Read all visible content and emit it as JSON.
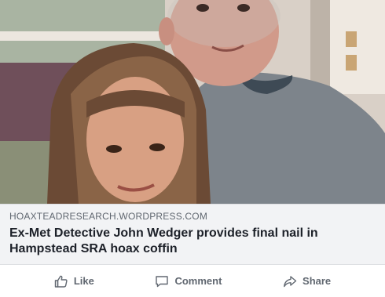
{
  "post": {
    "image": {
      "description_icon": "photo-of-man-and-woman"
    },
    "link_preview": {
      "domain": "HOAXTEADRESEARCH.WORDPRESS.COM",
      "headline": "Ex-Met Detective John Wedger provides final nail in Hampstead SRA hoax coffin"
    },
    "actions": [
      {
        "label": "Like",
        "icon": "thumbs-up-icon"
      },
      {
        "label": "Comment",
        "icon": "comment-icon"
      },
      {
        "label": "Share",
        "icon": "share-icon"
      }
    ]
  },
  "colors": {
    "preview_bg": "#f2f3f5",
    "domain_text": "#606770",
    "headline_text": "#1d2129",
    "action_text": "#606770"
  }
}
